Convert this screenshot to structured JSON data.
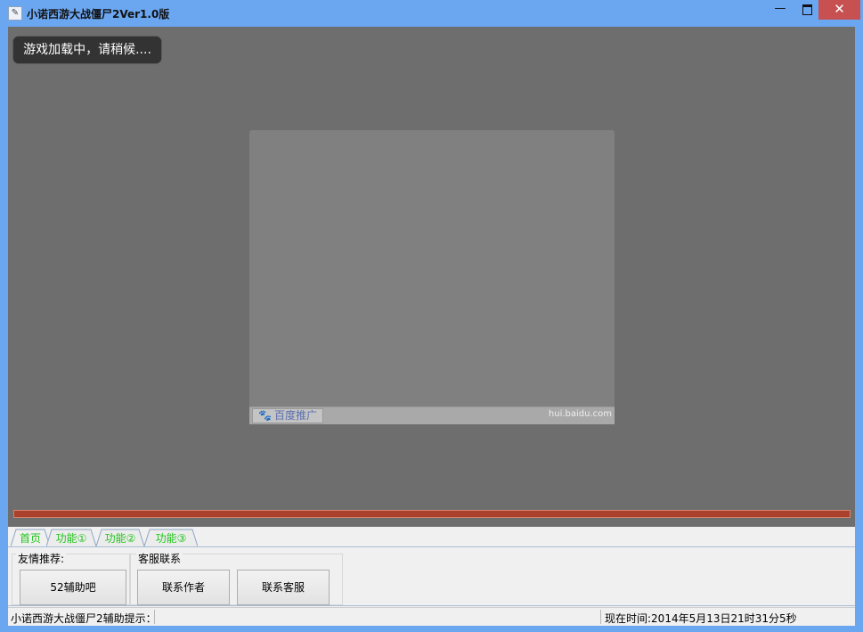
{
  "window": {
    "title": "小诺西游大战僵尸2Ver1.0版",
    "minimize_glyph": "—",
    "close_glyph": "✕"
  },
  "game": {
    "loading_text": "游戏加载中，请稍候....",
    "ad": {
      "logo_text": "百度推广",
      "url_text": "hui.baidu.com"
    },
    "progress": 1.0,
    "colors": {
      "progress": "#a9412c",
      "background": "#6e6e6e"
    }
  },
  "tabs": [
    {
      "label": "首页"
    },
    {
      "label": "功能①"
    },
    {
      "label": "功能②"
    },
    {
      "label": "功能③"
    }
  ],
  "panel": {
    "group1": {
      "title": "友情推荐:",
      "buttons": [
        "52辅助吧"
      ]
    },
    "group2": {
      "title": "客服联系",
      "buttons": [
        "联系作者",
        "联系客服"
      ]
    }
  },
  "status": {
    "tip": "小诺西游大战僵尸2辅助提示：",
    "time": "现在时间:2014年5月13日21时31分5秒"
  },
  "icons": [
    "app-icon",
    "minimize-icon",
    "maximize-icon",
    "close-icon",
    "baidu-paw-icon"
  ]
}
